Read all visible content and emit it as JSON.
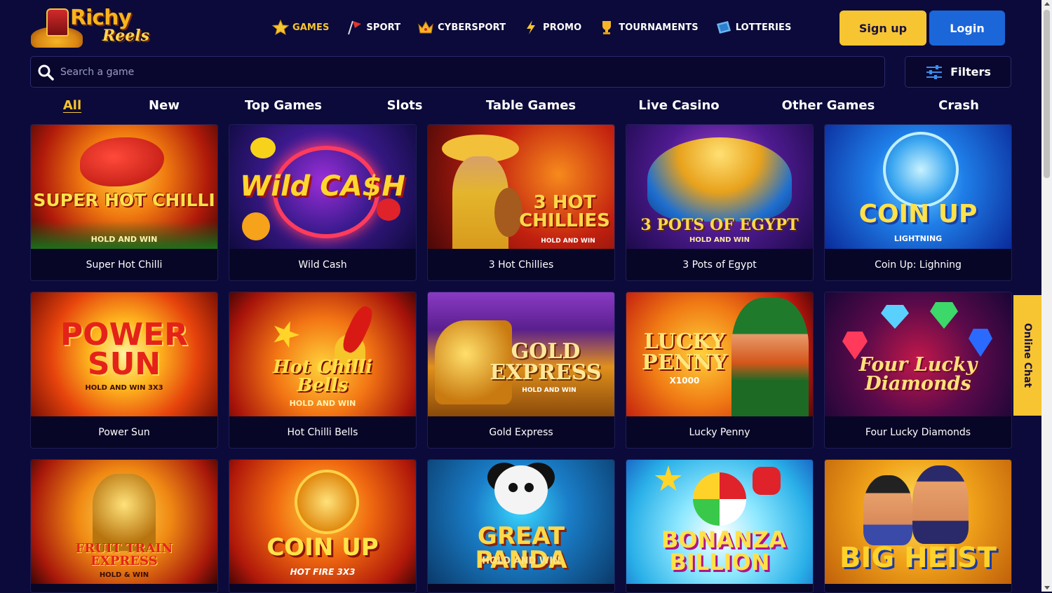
{
  "brand": {
    "line1": "Richy",
    "line2": "Reels"
  },
  "nav": [
    {
      "label": "GAMES",
      "icon": "star-icon",
      "active": true
    },
    {
      "label": "SPORT",
      "icon": "flag-icon",
      "active": false
    },
    {
      "label": "CYBERSPORT",
      "icon": "crown-icon",
      "active": false
    },
    {
      "label": "PROMO",
      "icon": "lightning-icon",
      "active": false
    },
    {
      "label": "TOURNAMENTS",
      "icon": "trophy-icon",
      "active": false
    },
    {
      "label": "LOTTERIES",
      "icon": "ticket-icon",
      "active": false
    }
  ],
  "auth": {
    "signup": "Sign up",
    "login": "Login"
  },
  "search": {
    "placeholder": "Search a game",
    "value": ""
  },
  "filters": {
    "label": "Filters"
  },
  "categories": [
    {
      "label": "All",
      "active": true
    },
    {
      "label": "New"
    },
    {
      "label": "Top Games"
    },
    {
      "label": "Slots"
    },
    {
      "label": "Table Games"
    },
    {
      "label": "Live Casino"
    },
    {
      "label": "Other Games"
    },
    {
      "label": "Crash"
    }
  ],
  "games": [
    {
      "name": "Super Hot Chilli",
      "art_title": "SUPER HOT CHILLI",
      "art_sub": "HOLD AND WIN"
    },
    {
      "name": "Wild Cash",
      "art_title": "Wild CA$H",
      "art_sub": ""
    },
    {
      "name": "3 Hot Chillies",
      "art_title": "3 HOT CHILLIES",
      "art_sub": "HOLD AND WIN"
    },
    {
      "name": "3 Pots of Egypt",
      "art_title": "3 POTS OF EGYPT",
      "art_sub": "HOLD AND WIN"
    },
    {
      "name": "Coin Up: Lighning",
      "art_title": "COIN UP",
      "art_sub": "LIGHTNING"
    },
    {
      "name": "Power Sun",
      "art_title": "POWER SUN",
      "art_sub": "HOLD AND WIN 3X3"
    },
    {
      "name": "Hot Chilli Bells",
      "art_title": "Hot Chilli Bells",
      "art_sub": "HOLD AND WIN"
    },
    {
      "name": "Gold Express",
      "art_title": "GOLD EXPRESS",
      "art_sub": "HOLD AND WIN"
    },
    {
      "name": "Lucky Penny",
      "art_title": "LUCKY PENNY",
      "art_sub": "X1000"
    },
    {
      "name": "Four Lucky Diamonds",
      "art_title": "Four Lucky Diamonds",
      "art_sub": ""
    },
    {
      "name": "",
      "art_title": "FRUIT TRAIN EXPRESS",
      "art_sub": "HOLD & WIN"
    },
    {
      "name": "",
      "art_title": "COIN UP",
      "art_sub": "HOT FIRE 3X3"
    },
    {
      "name": "",
      "art_title": "GREAT PANDA",
      "art_sub": "HOLD AND WIN"
    },
    {
      "name": "",
      "art_title": "BONANZA BILLION",
      "art_sub": ""
    },
    {
      "name": "",
      "art_title": "BIG HEIST",
      "art_sub": ""
    }
  ],
  "chat": {
    "label": "Online Chat"
  },
  "colors": {
    "background": "#0b0a3a",
    "accent": "#f6c531",
    "login": "#1b66d9"
  }
}
